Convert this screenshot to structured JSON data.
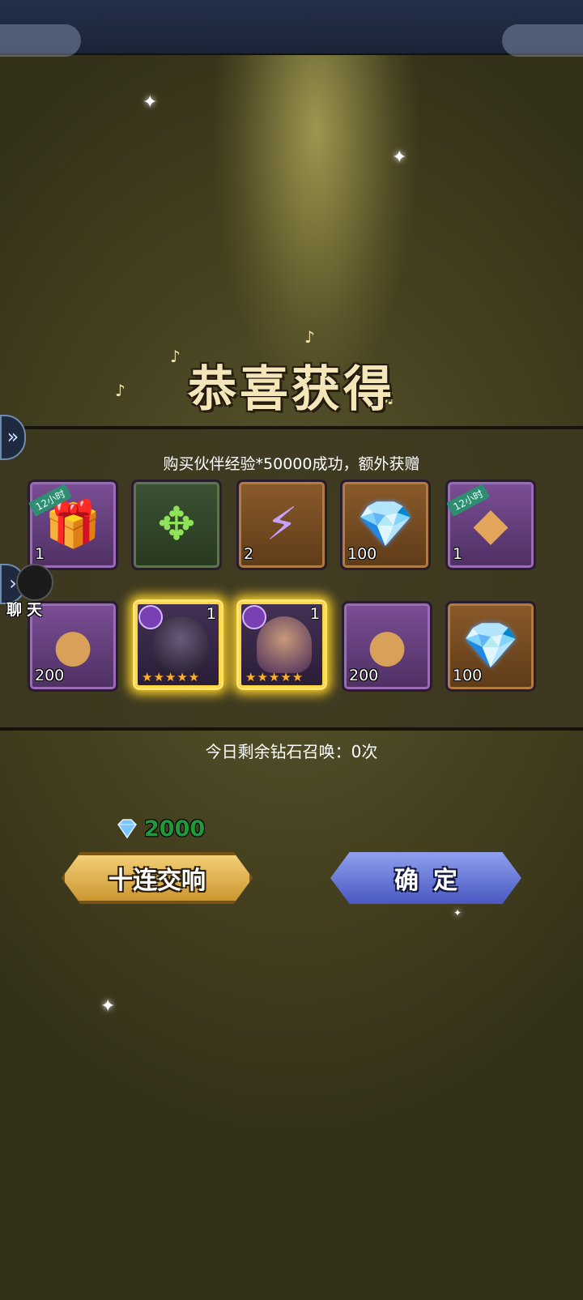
{
  "title": "恭喜获得",
  "subtitle": "购买伙伴经验*50000成功，额外获赠",
  "items": [
    {
      "icon": "exp-gift-box-icon",
      "badge": "12小时",
      "qty": "1",
      "frame": "purple"
    },
    {
      "icon": "green-emblem-icon",
      "badge": "",
      "qty": "",
      "frame": "green"
    },
    {
      "icon": "lightning-token-icon",
      "badge": "",
      "qty": "2",
      "frame": "bronze"
    },
    {
      "icon": "diamond-icon",
      "badge": "",
      "qty": "100",
      "frame": "bronze"
    },
    {
      "icon": "gold-ore-icon",
      "badge": "12小时",
      "qty": "1",
      "frame": "purple"
    },
    {
      "icon": "pouch-icon",
      "badge": "",
      "qty": "200",
      "frame": "purple"
    },
    {
      "icon": "dark-hero-portrait",
      "badge": "",
      "qty": "1",
      "frame": "hero"
    },
    {
      "icon": "bearded-hero-portrait",
      "badge": "",
      "qty": "1",
      "frame": "hero"
    },
    {
      "icon": "pouch-icon",
      "badge": "",
      "qty": "200",
      "frame": "purple"
    },
    {
      "icon": "diamond-icon",
      "badge": "",
      "qty": "100",
      "frame": "bronze"
    }
  ],
  "hero_stars": 5,
  "chat_label": "聊天",
  "remaining_summons": "今日剩余钻石召唤：0次",
  "cost": "2000",
  "buttons": {
    "summon_ten": "十连交响",
    "confirm": "确定"
  },
  "colors": {
    "cost_green": "#1e9a3a",
    "gold_button": "#e0b04d",
    "blue_button": "#6a78d8"
  }
}
